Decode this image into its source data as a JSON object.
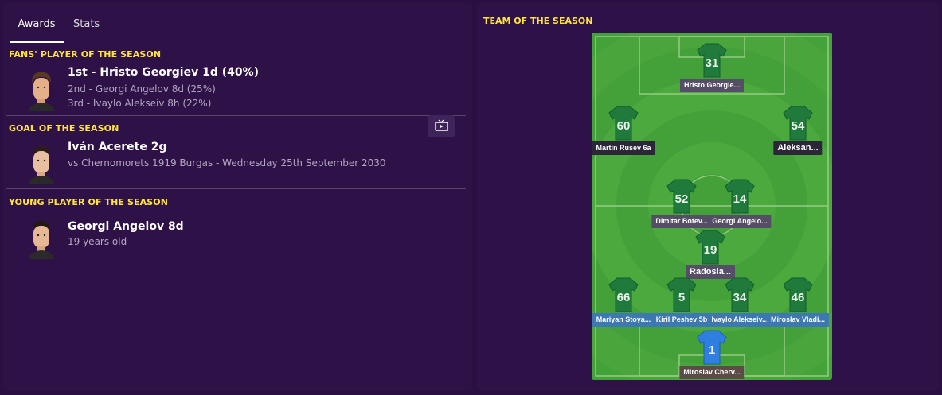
{
  "tabs": [
    {
      "label": "Awards"
    },
    {
      "label": "Stats"
    }
  ],
  "fans_player": {
    "title": "FANS' PLAYER OF THE SEASON",
    "first": "1st - Hristo Georgiev 1d (40%)",
    "second": "2nd - Georgi Angelov 8d (25%)",
    "third": "3rd - Ivaylo Alekseiv 8h (22%)"
  },
  "goal_of_season": {
    "title": "GOAL OF THE SEASON",
    "scorer": "Iván Acerete 2g",
    "detail": "vs Chernomorets 1919 Burgas - Wednesday 25th September 2030"
  },
  "young_player": {
    "title": "YOUNG PLAYER OF THE SEASON",
    "name": "Georgi Angelov 8d",
    "age": "19 years old"
  },
  "team_of_season": {
    "title": "TEAM OF THE SEASON",
    "players": [
      {
        "number": "31",
        "name": "Hristo Georgie...",
        "label_color": "gray"
      },
      {
        "number": "60",
        "name": "Martin Rusev 6a",
        "label_color": "dark"
      },
      {
        "number": "54",
        "name": "Aleksan...",
        "label_color": "dark"
      },
      {
        "number": "52",
        "name": "Dimitar Botev...",
        "label_color": "gray"
      },
      {
        "number": "14",
        "name": "Georgi Angelo...",
        "label_color": "gray"
      },
      {
        "number": "19",
        "name": "Radosla...",
        "label_color": "gray"
      },
      {
        "number": "66",
        "name": "Mariyan Stoya...",
        "label_color": "blue"
      },
      {
        "number": "5",
        "name": "Kiril Peshev 5b",
        "label_color": "blue"
      },
      {
        "number": "34",
        "name": "Ivaylo Alekseiv...",
        "label_color": "blue"
      },
      {
        "number": "46",
        "name": "Miroslav Vladi...",
        "label_color": "blue"
      },
      {
        "number": "1",
        "name": "Miroslav Cherv...",
        "label_color": "gk"
      }
    ]
  },
  "colors": {
    "accent_yellow": "#ffe43b",
    "pitch_green": "#4a9f3a",
    "shirt_green": "#1f7a3c",
    "gk_shirt": "#2f7fe0"
  }
}
